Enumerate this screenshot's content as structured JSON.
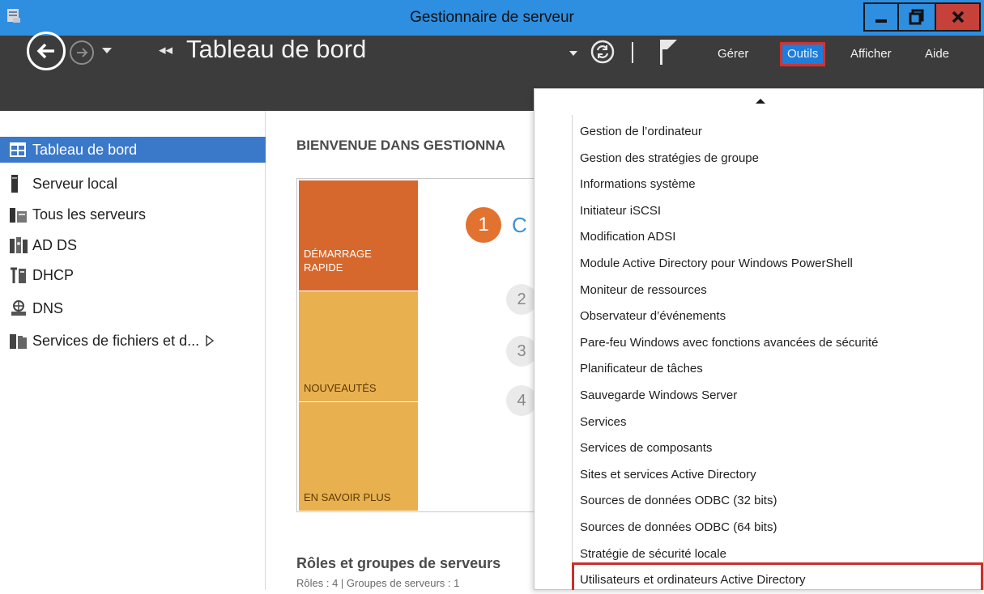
{
  "window": {
    "title": "Gestionnaire de serveur",
    "icon": "server-manager-icon",
    "controls": {
      "minimize": "minimize-icon",
      "maximize": "maximize-icon",
      "close": "close-icon"
    }
  },
  "header": {
    "crumb_arrows": "◂◂",
    "page_title": "Tableau de bord",
    "menu": {
      "gerer": "Gérer",
      "outils": "Outils",
      "afficher": "Afficher",
      "aide": "Aide"
    }
  },
  "sidebar": {
    "items": [
      {
        "label": "Tableau de bord",
        "icon": "dashboard-icon",
        "active": true
      },
      {
        "label": "Serveur local",
        "icon": "server-icon"
      },
      {
        "label": "Tous les serveurs",
        "icon": "servers-icon"
      },
      {
        "label": "AD DS",
        "icon": "ad-ds-icon"
      },
      {
        "label": "DHCP",
        "icon": "dhcp-icon"
      },
      {
        "label": "DNS",
        "icon": "dns-icon"
      },
      {
        "label": "Services de fichiers et d...",
        "icon": "file-services-icon",
        "expandable": true
      }
    ]
  },
  "main": {
    "welcome": "BIENVENUE DANS GESTIONNA",
    "tiles": {
      "demarrage_line1": "DÉMARRAGE",
      "demarrage_line2": "RAPIDE",
      "nouveautes": "NOUVEAUTÉS",
      "en_savoir_plus": "EN SAVOIR PLUS"
    },
    "steps": {
      "step1": "1",
      "step1_text": "C",
      "step2": "2",
      "step3": "3",
      "step4": "4"
    },
    "roles_title": "Rôles et groupes de serveurs",
    "roles_sub": "Rôles : 4   |   Groupes de serveurs : 1"
  },
  "tools_menu": {
    "items": [
      "Gestion de l’ordinateur",
      "Gestion des stratégies de groupe",
      "Informations système",
      "Initiateur iSCSI",
      "Modification ADSI",
      "Module Active Directory pour Windows PowerShell",
      "Moniteur de ressources",
      "Observateur d’événements",
      "Pare-feu Windows avec fonctions avancées de sécurité",
      "Planificateur de tâches",
      "Sauvegarde Windows Server",
      "Services",
      "Services de composants",
      "Sites et services Active Directory",
      "Sources de données ODBC (32 bits)",
      "Sources de données ODBC (64 bits)",
      "Stratégie de sécurité locale",
      "Utilisateurs et ordinateurs Active Directory"
    ]
  },
  "colors": {
    "titlebar": "#2e8ee0",
    "header": "#3c3c3c",
    "active_item": "#3a78c9",
    "highlight": "#d9302c",
    "tile_orange": "#d7682d",
    "tile_yellow": "#e9b050"
  }
}
